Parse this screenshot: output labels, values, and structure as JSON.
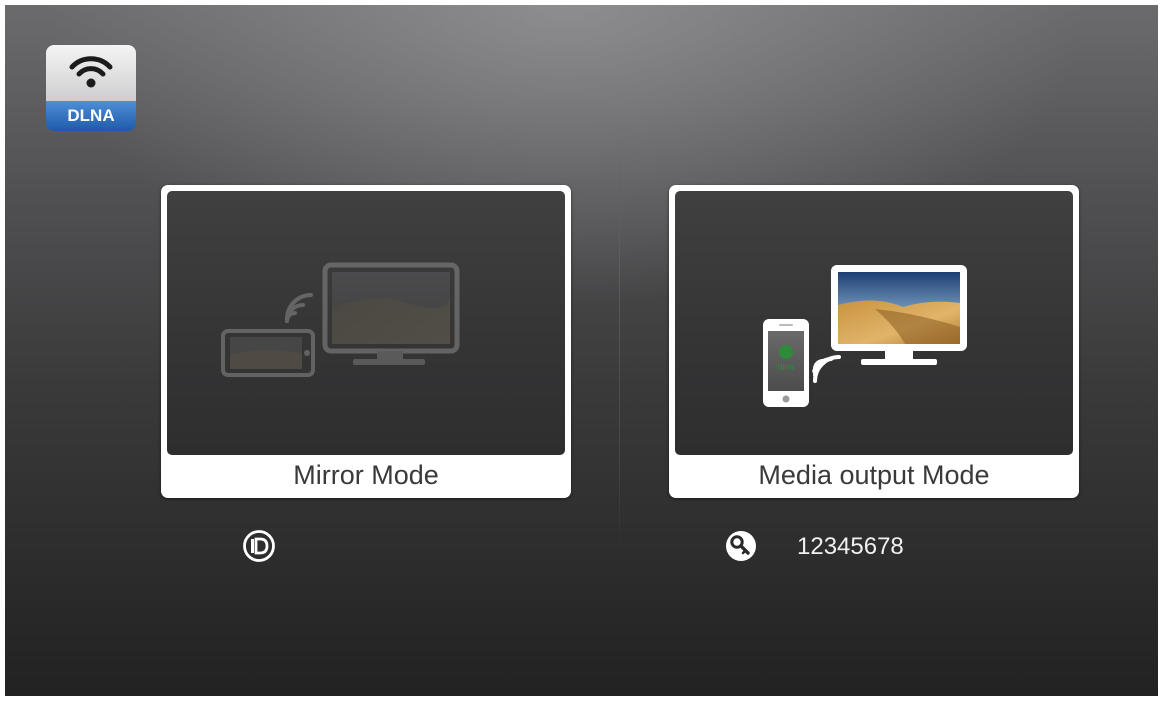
{
  "app": {
    "logo_label": "DLNA"
  },
  "modes": [
    {
      "label": "Mirror Mode",
      "state": "inactive"
    },
    {
      "label": "Media output Mode",
      "state": "active"
    }
  ],
  "mirror": {
    "id_icon": "id-icon",
    "device_id": ""
  },
  "media": {
    "key_icon": "key-icon",
    "password": "12345678"
  },
  "colors": {
    "dlna_blue": "#1e5aa8",
    "card_white": "#ffffff",
    "background_dark": "#222223"
  }
}
